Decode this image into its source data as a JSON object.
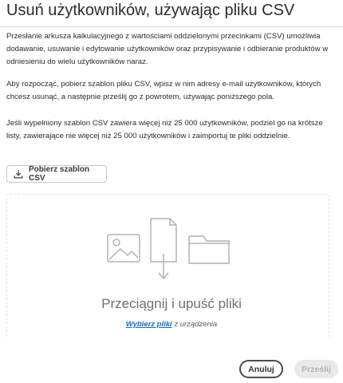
{
  "dialog": {
    "title": "Usuń użytkowników, używając pliku CSV",
    "paragraphs": [
      "Przesłanie arkusza kalkulacyjnego z wartościami oddzielonymi przecinkami (CSV) umożliwia dodawanie, usuwanie i edytowanie użytkowników oraz przypisywanie i odbieranie produktów w odniesieniu do wielu użytkowników naraz.",
      "Aby rozpocząć, pobierz szablon pliku CSV, wpisz w nim adresy e-mail użytkowników, których chcesz usunąć, a następnie prześlij go z powrotem, używając poniższego pola.",
      "Jeśli wypełniony szablon CSV zawiera więcej niż 25 000 użytkowników, podziel go na krótsze listy, zawierające nie więcej niż 25 000 użytkowników i zaimportuj te pliki oddzielnie."
    ],
    "download_label": "Pobierz szablon CSV",
    "download_icon": "download-icon"
  },
  "dropzone": {
    "title": "Przeciągnij i upuść pliki",
    "link_label": "Wybierz pliki",
    "rest_label": " z urządzenia",
    "icons": [
      "image-icon",
      "file-upload-icon",
      "folder-icon"
    ]
  },
  "footer": {
    "cancel_label": "Anuluj",
    "submit_label": "Prześlij"
  },
  "colors": {
    "link": "#1a6fc4",
    "disabled_button_bg": "#e9e9e9",
    "illustration_stroke": "#b3b3b3"
  }
}
